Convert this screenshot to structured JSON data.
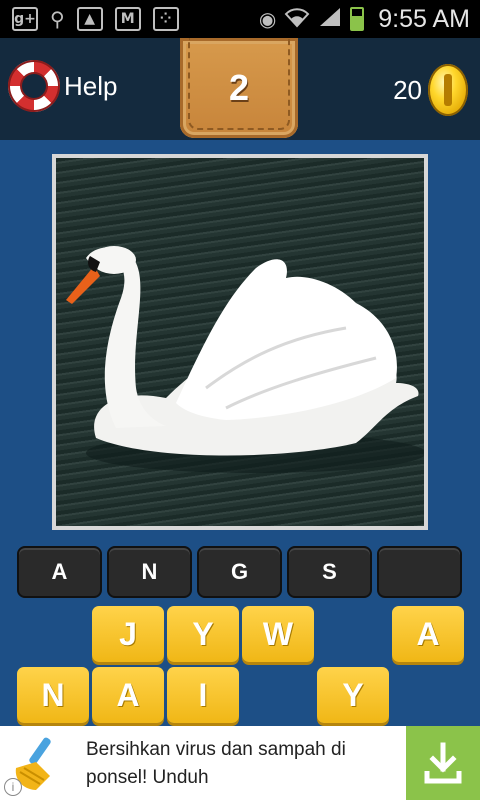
{
  "status_bar": {
    "icons": [
      "google-plus-icon",
      "usb-icon",
      "gallery-icon",
      "gmail-icon",
      "blackberry-icon"
    ],
    "time": "9:55 AM"
  },
  "header": {
    "help_label": "Help",
    "level": "2",
    "coins": "20"
  },
  "puzzle": {
    "image_subject": "swan-photo"
  },
  "answer_slots": [
    "A",
    "N",
    "G",
    "S",
    ""
  ],
  "tiles": {
    "row1": [
      "J",
      "Y",
      "W",
      "A"
    ],
    "row2": [
      "N",
      "A",
      "I",
      "Y"
    ]
  },
  "ad": {
    "text": "Bersihkan virus dan sampah di ponsel! Unduh"
  },
  "colors": {
    "background": "#1d4f86",
    "header": "#142a3e",
    "tile": "#f0b716",
    "slot": "#2a2a2a",
    "ad_accent": "#8bc34a"
  }
}
